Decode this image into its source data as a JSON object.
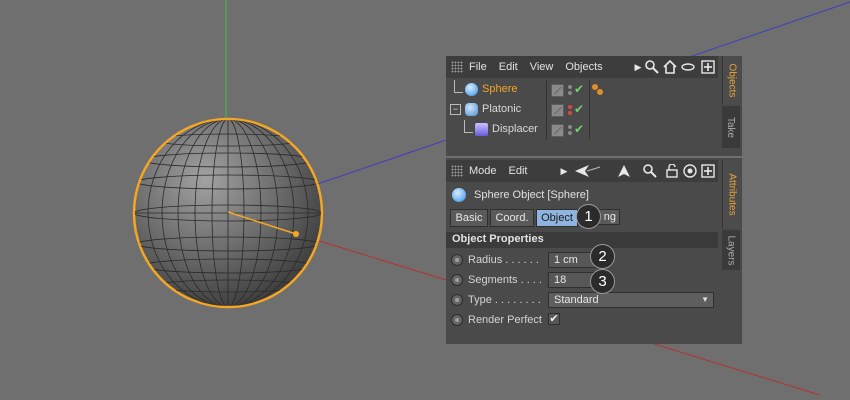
{
  "object_manager": {
    "menu": [
      "File",
      "Edit",
      "View",
      "Objects"
    ],
    "objects": [
      {
        "name": "Sphere",
        "selected": true,
        "icon": "sphere-icon",
        "color": "#f5a623"
      },
      {
        "name": "Platonic",
        "selected": false,
        "icon": "platonic-icon"
      },
      {
        "name": "Displacer",
        "selected": false,
        "icon": "displacer-icon"
      }
    ],
    "side_tabs": [
      "Objects",
      "Take"
    ]
  },
  "attribute_manager": {
    "menu": [
      "Mode",
      "Edit"
    ],
    "title": "Sphere Object [Sphere]",
    "tabs": [
      "Basic",
      "Coord.",
      "Object",
      "ng"
    ],
    "selected_tab": "Object",
    "section_title": "Object Properties",
    "properties": {
      "radius_label": "Radius . . . . . .",
      "radius_value": "1 cm",
      "segments_label": "Segments . . . .",
      "segments_value": "18",
      "type_label": "Type . . . . . . . .",
      "type_value": "Standard",
      "render_perfect_label": "Render Perfect",
      "render_perfect_checked": "✔"
    },
    "side_tabs": [
      "Attributes",
      "Layers"
    ]
  },
  "callouts": [
    "1",
    "2",
    "3"
  ],
  "colors": {
    "accent": "#f5a623",
    "selection": "#8fb4df",
    "check_green": "#6fd06f",
    "viewport_bg": "#6f6f6f"
  }
}
